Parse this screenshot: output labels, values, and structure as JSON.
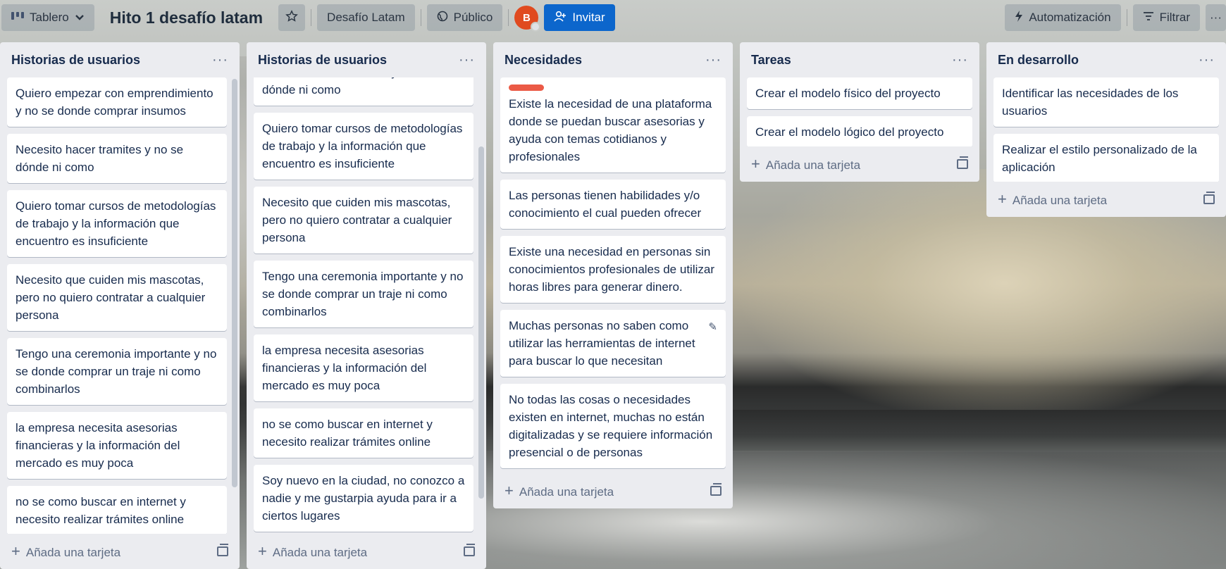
{
  "header": {
    "view_label": "Tablero",
    "board_title": "Hito 1 desafío latam",
    "workspace_label": "Desafío Latam",
    "visibility_label": "Público",
    "avatar_initial": "B",
    "invite_label": "Invitar",
    "automation_label": "Automatización",
    "filter_label": "Filtrar",
    "more_label": "···"
  },
  "add_card_label": "Añada una tarjeta",
  "lists": [
    {
      "title": "Historias de usuarios",
      "cards": [
        "Quiero empezar con emprendimiento y no se donde comprar insumos",
        "Necesito hacer tramites y no se dónde ni como",
        "Quiero tomar cursos de metodologías de trabajo y la información que encuentro es insuficiente",
        "Necesito que cuiden mis mascotas, pero no quiero contratar a cualquier persona",
        "Tengo una ceremonia importante y no se donde comprar un traje ni como combinarlos",
        "la empresa necesita asesorias financieras y la información del mercado es muy poca",
        "no se como buscar en internet y necesito realizar trámites online"
      ]
    },
    {
      "title": "Historias de usuarios",
      "cards": [
        "Necesito hacer tramites y no se dónde ni como",
        "Quiero tomar cursos de metodologías de trabajo y la información que encuentro es insuficiente",
        "Necesito que cuiden mis mascotas, pero no quiero contratar a cualquier persona",
        "Tengo una ceremonia importante y no se donde comprar un traje ni como combinarlos",
        "la empresa necesita asesorias financieras y la información del mercado es muy poca",
        "no se como buscar en internet y necesito realizar trámites online",
        "Soy nuevo en la ciudad, no conozco a nadie y me gustarpia ayuda para ir a ciertos lugares"
      ]
    },
    {
      "title": "Necesidades",
      "cards": [
        "Existe la necesidad de una plataforma donde se puedan buscar asesorias y ayuda con temas cotidianos y profesionales",
        "Las personas tienen habilidades y/o conocimiento el cual pueden ofrecer",
        "Existe una necesidad en personas sin conocimientos profesionales de utilizar horas libres para generar dinero.",
        "Muchas personas no saben como utilizar las herramientas de internet para buscar lo que necesitan",
        "No todas las cosas o necesidades existen en internet, muchas no están digitalizadas y se requiere información presencial o de personas"
      ]
    },
    {
      "title": "Tareas",
      "cards": [
        "Crear el modelo físico del proyecto",
        "Crear el modelo lógico del proyecto"
      ]
    },
    {
      "title": "En desarrollo",
      "cards": [
        "Identificar las necesidades de los usuarios",
        "Realizar el estilo personalizado de la aplicación"
      ]
    }
  ],
  "colors": {
    "label_red": "#eb5a46",
    "invite_blue": "#0c66cc",
    "avatar": "#e04a1f"
  }
}
